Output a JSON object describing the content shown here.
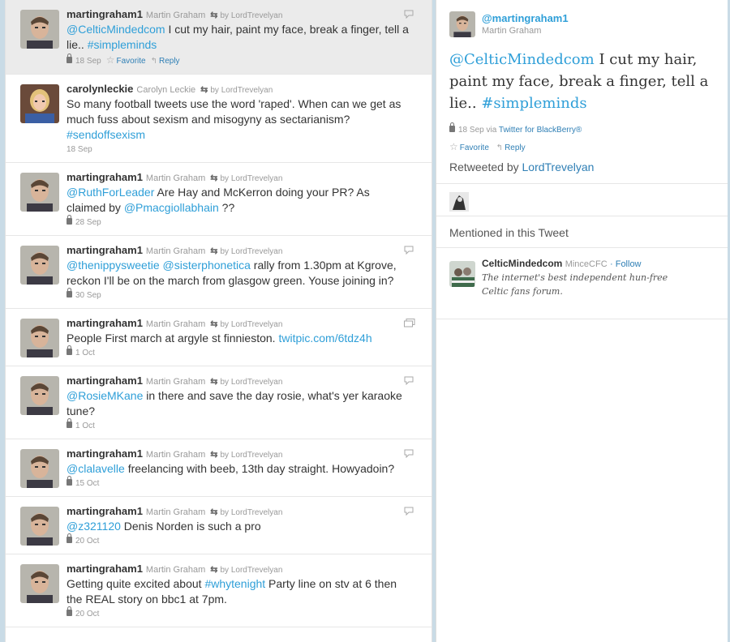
{
  "timeline": {
    "tweets": [
      {
        "screen": "martingraham1",
        "name": "Martin Graham",
        "rt_by": "by LordTrevelyan",
        "lines": [
          [
            {
              "t": "@CelticMindedcom",
              "l": true
            },
            {
              "t": " I cut my hair, paint my face, break a finger, tell a",
              "l": false
            }
          ],
          [
            {
              "t": "lie.. ",
              "l": false
            },
            {
              "t": "#simpleminds",
              "l": true
            }
          ]
        ],
        "date": "18 Sep",
        "actions": [
          "Favorite",
          "Reply"
        ],
        "corner": "reply-bubble"
      },
      {
        "screen": "carolynleckie",
        "name": "Carolyn Leckie",
        "rt_by": "by LordTrevelyan",
        "lines": [
          [
            {
              "t": "So many football tweets use the word 'raped'. When can we get as",
              "l": false
            }
          ],
          [
            {
              "t": "much fuss about sexism and misogyny as sectarianism?",
              "l": false
            }
          ],
          [
            {
              "t": "#sendoffsexism",
              "l": true
            }
          ]
        ],
        "date": "18 Sep",
        "actions": [],
        "corner": ""
      },
      {
        "screen": "martingraham1",
        "name": "Martin Graham",
        "rt_by": "by LordTrevelyan",
        "lines": [
          [
            {
              "t": "@RuthForLeader",
              "l": true
            },
            {
              "t": " Are Hay and McKerron doing your PR? As",
              "l": false
            }
          ],
          [
            {
              "t": "claimed by ",
              "l": false
            },
            {
              "t": "@Pmacgiollabhain",
              "l": true
            },
            {
              "t": " ??",
              "l": false
            }
          ]
        ],
        "date": "28 Sep",
        "actions": [],
        "corner": ""
      },
      {
        "screen": "martingraham1",
        "name": "Martin Graham",
        "rt_by": "by LordTrevelyan",
        "lines": [
          [
            {
              "t": "@thenippysweetie",
              "l": true
            },
            {
              "t": " ",
              "l": false
            },
            {
              "t": "@sisterphonetica",
              "l": true
            },
            {
              "t": " rally from 1.30pm at Kgrove,",
              "l": false
            }
          ],
          [
            {
              "t": "reckon I'll be on the march from glasgow green. Youse joining in?",
              "l": false
            }
          ]
        ],
        "date": "30 Sep",
        "actions": [],
        "corner": "reply-bubble"
      },
      {
        "screen": "martingraham1",
        "name": "Martin Graham",
        "rt_by": "by LordTrevelyan",
        "lines": [
          [
            {
              "t": "People First march at argyle st finnieston. ",
              "l": false
            },
            {
              "t": "twitpic.com/6tdz4h",
              "l": true
            }
          ]
        ],
        "date": "1 Oct",
        "actions": [],
        "corner": "photo"
      },
      {
        "screen": "martingraham1",
        "name": "Martin Graham",
        "rt_by": "by LordTrevelyan",
        "lines": [
          [
            {
              "t": "@RosieMKane",
              "l": true
            },
            {
              "t": " in there and save the day rosie, what's yer karaoke",
              "l": false
            }
          ],
          [
            {
              "t": "tune?",
              "l": false
            }
          ]
        ],
        "date": "1 Oct",
        "actions": [],
        "corner": "reply-bubble"
      },
      {
        "screen": "martingraham1",
        "name": "Martin Graham",
        "rt_by": "by LordTrevelyan",
        "lines": [
          [
            {
              "t": "@clalavelle",
              "l": true
            },
            {
              "t": " freelancing with beeb, 13th day straight. Howyadoin?",
              "l": false
            }
          ]
        ],
        "date": "15 Oct",
        "actions": [],
        "corner": "reply-bubble"
      },
      {
        "screen": "martingraham1",
        "name": "Martin Graham",
        "rt_by": "by LordTrevelyan",
        "lines": [
          [
            {
              "t": "@z321120",
              "l": true
            },
            {
              "t": " Denis Norden is such a pro",
              "l": false
            }
          ]
        ],
        "date": "20 Oct",
        "actions": [],
        "corner": "reply-bubble"
      },
      {
        "screen": "martingraham1",
        "name": "Martin Graham",
        "rt_by": "by LordTrevelyan",
        "lines": [
          [
            {
              "t": "Getting quite excited about ",
              "l": false
            },
            {
              "t": "#whytenight",
              "l": true
            },
            {
              "t": " Party line on stv at 6 then",
              "l": false
            }
          ],
          [
            {
              "t": "the REAL story on bbc1 at 7pm.",
              "l": false
            }
          ]
        ],
        "date": "20 Oct",
        "actions": [],
        "corner": ""
      }
    ]
  },
  "detail": {
    "handle": "@martingraham1",
    "name": "Martin Graham",
    "text_parts": [
      {
        "t": "@CelticMindedcom",
        "l": true
      },
      {
        "t": " I cut my hair, paint my face, break a finger, tell a lie.. ",
        "l": false
      },
      {
        "t": "#simpleminds",
        "l": true
      }
    ],
    "date": "18 Sep",
    "via_label": "via",
    "via_client": "Twitter for BlackBerry®",
    "favorite_label": "Favorite",
    "reply_label": "Reply",
    "retweeted_by_label": "Retweeted by",
    "retweeted_by_user": "LordTrevelyan",
    "mentioned_heading": "Mentioned in this Tweet",
    "mention": {
      "name": "CelticMindedcom",
      "handle": "MinceCFC",
      "follow_label": "· Follow",
      "bio_line1": "The internet's best independent hun-free",
      "bio_line2": "Celtic fans forum."
    }
  },
  "colors": {
    "link": "#2f9fd8",
    "action": "#2f7fb5",
    "background": "#c9dbe6"
  }
}
